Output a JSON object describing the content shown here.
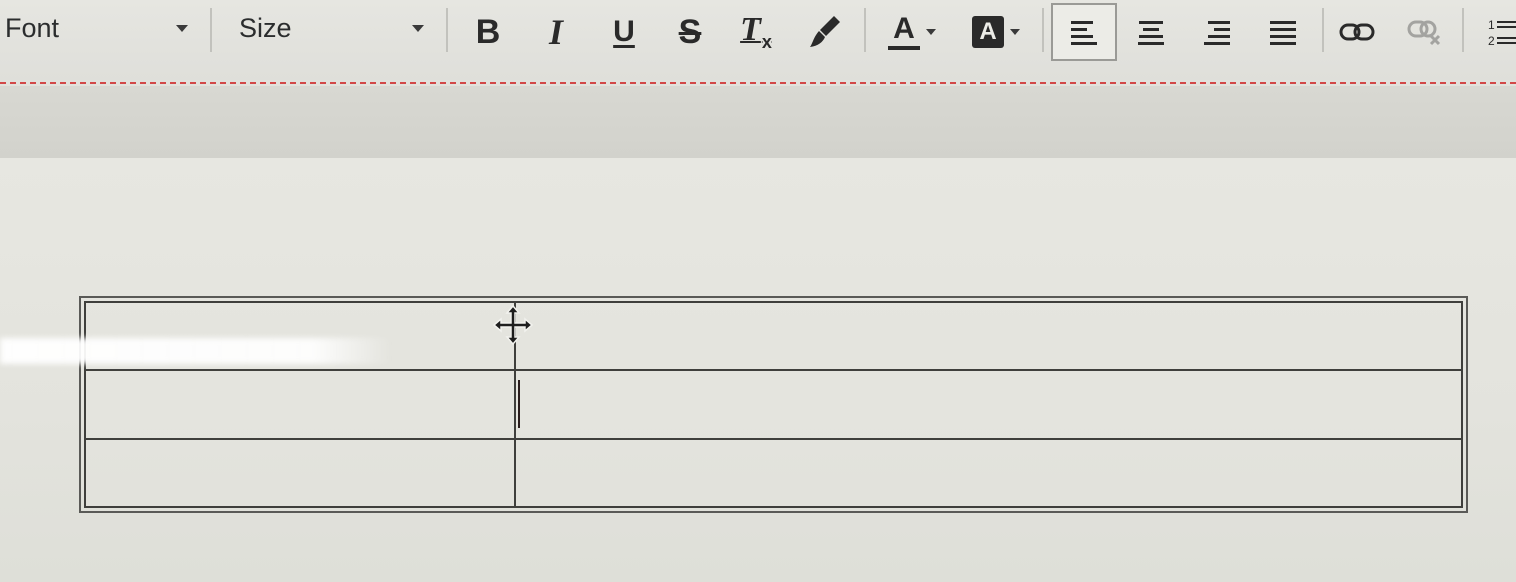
{
  "toolbar": {
    "font_dropdown": {
      "label": "Font"
    },
    "size_dropdown": {
      "label": "Size"
    },
    "buttons": {
      "bold": "B",
      "italic": "I",
      "underline": "U",
      "strikethrough": "S",
      "clear_format": "T",
      "clear_format_sub": "x",
      "text_color": "A",
      "background_color": "A"
    },
    "icons": {
      "format_painter": "paintbrush-icon",
      "align_left": "align-left-icon",
      "align_center": "align-center-icon",
      "align_right": "align-right-icon",
      "align_justify": "align-justify-icon",
      "link": "link-icon",
      "unlink": "unlink-icon",
      "numbered_list": "numbered-list-icon"
    },
    "active_button": "align_left"
  },
  "editor": {
    "table": {
      "rows": [
        [
          "",
          ""
        ],
        [
          "",
          ""
        ],
        [
          "",
          ""
        ]
      ]
    },
    "cursor": "move-cursor",
    "page_break_color": "#d24848"
  }
}
